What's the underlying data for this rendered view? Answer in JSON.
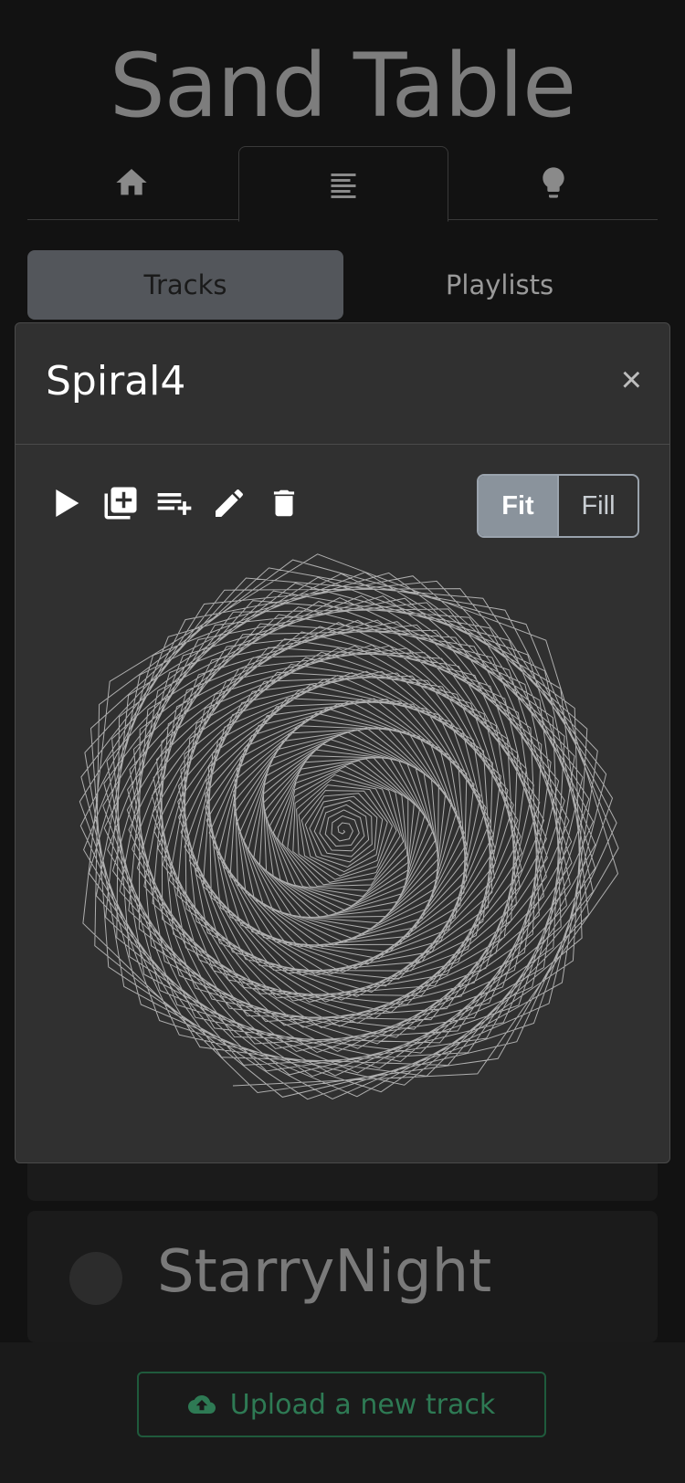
{
  "app": {
    "title": "Sand Table"
  },
  "nav": {
    "tabs": [
      {
        "icon": "home-icon"
      },
      {
        "icon": "list-icon"
      },
      {
        "icon": "lightbulb-icon"
      }
    ],
    "active_index": 1
  },
  "segments": {
    "tracks_label": "Tracks",
    "playlists_label": "Playlists",
    "active": "Tracks"
  },
  "tracks": [
    {
      "name": "StarryNight"
    }
  ],
  "modal": {
    "title": "Spiral4",
    "close_label": "×",
    "toolbar": [
      "play-icon",
      "add-to-queue-icon",
      "add-to-playlist-icon",
      "edit-icon",
      "delete-icon"
    ],
    "fit_label": "Fit",
    "fill_label": "Fill",
    "fit_mode": "Fit"
  },
  "upload": {
    "label": "Upload a new track",
    "icon": "cloud-upload-icon"
  },
  "colors": {
    "accent_green": "#2e7a54",
    "background": "#121212",
    "modal_bg": "#303030"
  }
}
